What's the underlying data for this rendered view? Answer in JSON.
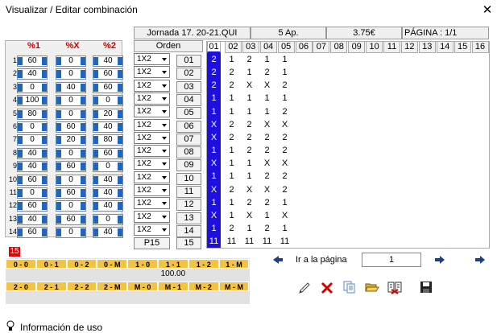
{
  "window": {
    "title": "Visualizar / Editar combinación",
    "close": "✕"
  },
  "percent_headers": [
    "%1",
    "%X",
    "%2"
  ],
  "percent_rows": [
    {
      "n": "1",
      "p1": "60",
      "px": "0",
      "p2": "40"
    },
    {
      "n": "2",
      "p1": "40",
      "px": "0",
      "p2": "60"
    },
    {
      "n": "3",
      "p1": "0",
      "px": "40",
      "p2": "60"
    },
    {
      "n": "4",
      "p1": "100",
      "px": "0",
      "p2": "0"
    },
    {
      "n": "5",
      "p1": "80",
      "px": "0",
      "p2": "20"
    },
    {
      "n": "6",
      "p1": "0",
      "px": "60",
      "p2": "40"
    },
    {
      "n": "7",
      "p1": "0",
      "px": "20",
      "p2": "80"
    },
    {
      "n": "8",
      "p1": "40",
      "px": "0",
      "p2": "60"
    },
    {
      "n": "9",
      "p1": "40",
      "px": "60",
      "p2": "0"
    },
    {
      "n": "10",
      "p1": "60",
      "px": "0",
      "p2": "40"
    },
    {
      "n": "11",
      "p1": "0",
      "px": "60",
      "p2": "40"
    },
    {
      "n": "12",
      "p1": "60",
      "px": "0",
      "p2": "40"
    },
    {
      "n": "13",
      "p1": "40",
      "px": "60",
      "p2": "0"
    },
    {
      "n": "14",
      "p1": "60",
      "px": "0",
      "p2": "40"
    }
  ],
  "info_bar": {
    "jornada": "Jornada 17. 20-21.QUI",
    "apuestas": "5 Ap.",
    "precio": "3.75€",
    "pagina": "PÁGINA : 1/1"
  },
  "orden_label": "Orden",
  "combo_value": "1X2",
  "match_numbers": [
    "01",
    "02",
    "03",
    "04",
    "05",
    "06",
    "07",
    "08",
    "09",
    "10",
    "11",
    "12",
    "13",
    "14"
  ],
  "p15_label": "P15",
  "p15_number": "15",
  "columns": [
    "01",
    "02",
    "03",
    "04",
    "05",
    "06",
    "07",
    "08",
    "09",
    "10",
    "11",
    "12",
    "13",
    "14",
    "15",
    "16"
  ],
  "grid": [
    [
      "2",
      "1",
      "2",
      "1",
      "1"
    ],
    [
      "2",
      "2",
      "1",
      "2",
      "1"
    ],
    [
      "2",
      "2",
      "X",
      "X",
      "2"
    ],
    [
      "1",
      "1",
      "1",
      "1",
      "1"
    ],
    [
      "1",
      "1",
      "1",
      "1",
      "2"
    ],
    [
      "X",
      "2",
      "2",
      "X",
      "X"
    ],
    [
      "X",
      "2",
      "2",
      "2",
      "2"
    ],
    [
      "1",
      "1",
      "2",
      "2",
      "2"
    ],
    [
      "X",
      "1",
      "1",
      "X",
      "X"
    ],
    [
      "1",
      "1",
      "1",
      "2",
      "2"
    ],
    [
      "X",
      "2",
      "X",
      "X",
      "2"
    ],
    [
      "1",
      "1",
      "2",
      "2",
      "1"
    ],
    [
      "X",
      "1",
      "X",
      "1",
      "X"
    ],
    [
      "1",
      "2",
      "1",
      "2",
      "1"
    ]
  ],
  "grid_p15": [
    "11",
    "11",
    "11",
    "11",
    "11"
  ],
  "pleno_badge": "15",
  "legend": {
    "row1_labels": [
      "0 - 0",
      "0 - 1",
      "0 - 2",
      "0 - M",
      "1 - 0",
      "1 - 1",
      "1 - 2",
      "1 - M"
    ],
    "row1_values": [
      "",
      "",
      "",
      "",
      "",
      "100.00",
      "",
      ""
    ],
    "row2_labels": [
      "2 - 0",
      "2 - 1",
      "2 - 2",
      "2 - M",
      "M - 0",
      "M - 1",
      "M - 2",
      "M - M"
    ],
    "row2_values": [
      "",
      "",
      "",
      "",
      "",
      "",
      "",
      ""
    ]
  },
  "nav": {
    "label": "Ir a la página",
    "page_value": "1"
  },
  "footer": {
    "info": "Información de uso"
  },
  "colors": {
    "selected_column": "#1c0fe0",
    "legend_header": "#f5c342",
    "percent_header": "#cc0000"
  }
}
